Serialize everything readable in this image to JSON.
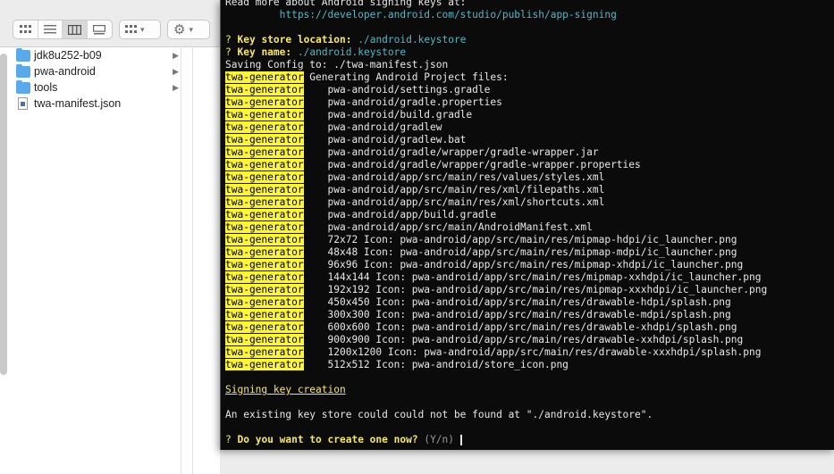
{
  "finder": {
    "toolbar": {
      "view_buttons": [
        "icon-view-icon",
        "list-view-icon",
        "column-view-icon",
        "gallery-view-icon"
      ],
      "group_button_icon": "group-grid-icon",
      "action_button_icon": "gear-icon"
    },
    "items": [
      {
        "name": "jdk8u252-b09",
        "kind": "folder"
      },
      {
        "name": "pwa-android",
        "kind": "folder"
      },
      {
        "name": "tools",
        "kind": "folder"
      },
      {
        "name": "twa-manifest.json",
        "kind": "file"
      }
    ]
  },
  "terminal": {
    "intro_line1": "Read more about Android signing keys at:",
    "intro_url": "         https://developer.android.com/studio/publish/app-signing",
    "q_mark": "?",
    "keystore_label": "Key store location:",
    "keystore_value": "./android.keystore",
    "keyname_label": "Key name:",
    "keyname_value": "./android.keystore",
    "saving": "Saving Config to: ./twa-manifest.json",
    "tag": "twa-generator",
    "generating": " Generating Android Project files:",
    "files": [
      "    pwa-android/settings.gradle",
      "    pwa-android/gradle.properties",
      "    pwa-android/build.gradle",
      "    pwa-android/gradlew",
      "    pwa-android/gradlew.bat",
      "    pwa-android/gradle/wrapper/gradle-wrapper.jar",
      "    pwa-android/gradle/wrapper/gradle-wrapper.properties",
      "    pwa-android/app/src/main/res/values/styles.xml",
      "    pwa-android/app/src/main/res/xml/filepaths.xml",
      "    pwa-android/app/src/main/res/xml/shortcuts.xml",
      "    pwa-android/app/build.gradle",
      "    pwa-android/app/src/main/AndroidManifest.xml",
      "    72x72 Icon: pwa-android/app/src/main/res/mipmap-hdpi/ic_launcher.png",
      "    48x48 Icon: pwa-android/app/src/main/res/mipmap-mdpi/ic_launcher.png",
      "    96x96 Icon: pwa-android/app/src/main/res/mipmap-xhdpi/ic_launcher.png",
      "    144x144 Icon: pwa-android/app/src/main/res/mipmap-xxhdpi/ic_launcher.png",
      "    192x192 Icon: pwa-android/app/src/main/res/mipmap-xxxhdpi/ic_launcher.png",
      "    450x450 Icon: pwa-android/app/src/main/res/drawable-hdpi/splash.png",
      "    300x300 Icon: pwa-android/app/src/main/res/drawable-mdpi/splash.png",
      "    600x600 Icon: pwa-android/app/src/main/res/drawable-xhdpi/splash.png",
      "    900x900 Icon: pwa-android/app/src/main/res/drawable-xxhdpi/splash.png",
      "    1200x1200 Icon: pwa-android/app/src/main/res/drawable-xxxhdpi/splash.png",
      "    512x512 Icon: pwa-android/store_icon.png"
    ],
    "signing_heading": "Signing key creation",
    "not_found": "An existing key store could could not be found at \"./android.keystore\".",
    "prompt_question": "Do you want to create one now?",
    "prompt_hint": "(Y/n)"
  },
  "colors": {
    "terminal_bg": "#0b0b0b",
    "tag_bg": "#fdf53c",
    "prompt_yellow": "#f5e66b",
    "value_cyan": "#56b6c2"
  }
}
